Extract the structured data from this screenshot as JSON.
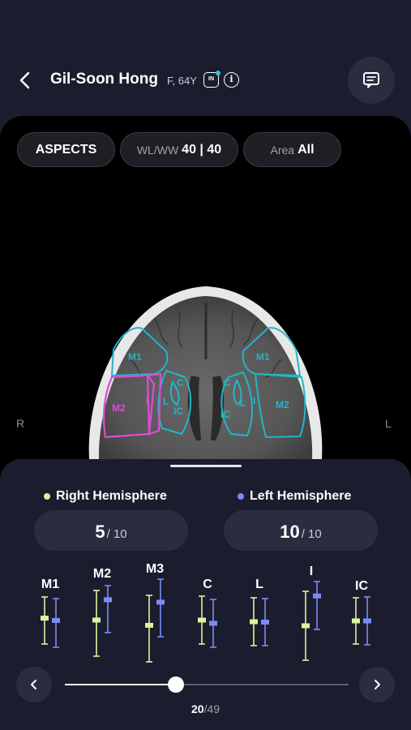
{
  "header": {
    "patient_name": "Gil-Soon Hong",
    "patient_meta": "F, 64Y",
    "in_badge": "IN"
  },
  "viewer": {
    "aspects_label": "ASPECTS",
    "wl_ww_label": "WL/WW",
    "wl_ww_value": "40 | 40",
    "area_label": "Area",
    "area_value": "All",
    "side_right": "R",
    "side_left": "L",
    "region_labels_right": [
      "M1",
      "M2",
      "I",
      "L",
      "C",
      "IC"
    ],
    "region_labels_left": [
      "M1",
      "M2",
      "C",
      "L",
      "I",
      "IC"
    ]
  },
  "colors": {
    "right": "#d9f59e",
    "left": "#7b8cf5",
    "cyan_outline": "#1fb6c9",
    "magenta_outline": "#e04bd6"
  },
  "scores": {
    "right_title": "Right Hemisphere",
    "left_title": "Left Hemisphere",
    "right_score": "5",
    "left_score": "10",
    "denominator": "/ 10"
  },
  "regions": [
    {
      "label": "M1",
      "right": 0.55,
      "left": 0.55
    },
    {
      "label": "M2",
      "right": 0.55,
      "left": 0.7
    },
    {
      "label": "M3",
      "right": 0.55,
      "left": 0.6
    },
    {
      "label": "C",
      "right": 0.5,
      "left": 0.5
    },
    {
      "label": "L",
      "right": 0.5,
      "left": 0.5
    },
    {
      "label": "I",
      "right": 0.5,
      "left": 0.7
    },
    {
      "label": "IC",
      "right": 0.5,
      "left": 0.5
    }
  ],
  "navigation": {
    "current": "20",
    "total": "/49",
    "progress": 0.39
  }
}
